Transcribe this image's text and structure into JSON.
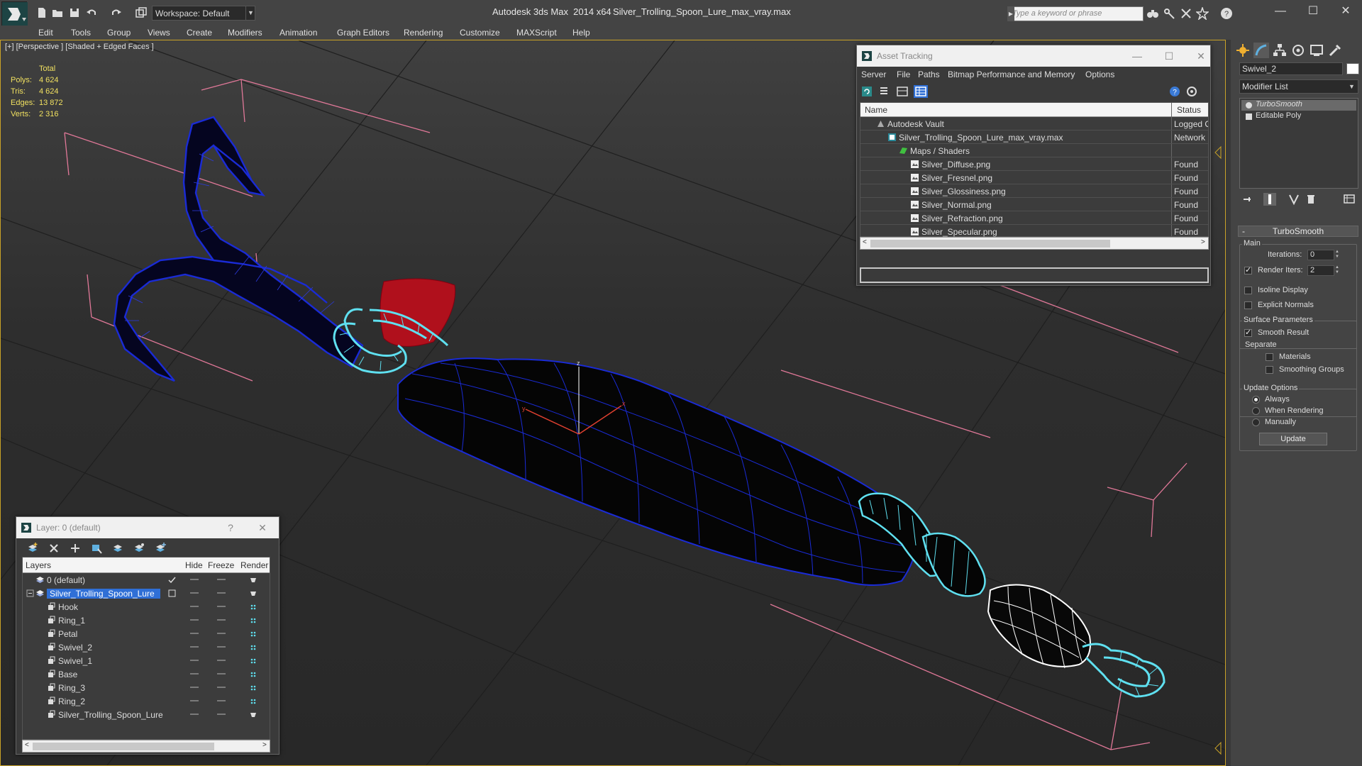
{
  "titlebar": {
    "workspace": "Workspace: Default",
    "app_title": "Autodesk 3ds Max  2014 x64",
    "doc_title": "Silver_Trolling_Spoon_Lure_max_vray.max",
    "search_placeholder": "Type a keyword or phrase",
    "minimize": "—",
    "maximize": "☐",
    "close": "✕"
  },
  "menu": [
    "Edit",
    "Tools",
    "Group",
    "Views",
    "Create",
    "Modifiers",
    "Animation",
    "Graph Editors",
    "Rendering",
    "Customize",
    "MAXScript",
    "Help"
  ],
  "viewport": {
    "label": "[+] [Perspective ] [Shaded + Edged Faces ]",
    "stats_header": "Total",
    "stats": [
      {
        "label": "Polys:",
        "value": "4 624"
      },
      {
        "label": "Tris:",
        "value": "4 624"
      },
      {
        "label": "Edges:",
        "value": "13 872"
      },
      {
        "label": "Verts:",
        "value": "2 316"
      }
    ]
  },
  "asset_tracking": {
    "title": "Asset Tracking",
    "menu": [
      "Server",
      "File",
      "Paths",
      "Bitmap Performance and Memory",
      "Options"
    ],
    "columns": {
      "name": "Name",
      "status": "Status"
    },
    "rows": [
      {
        "name": "Autodesk Vault",
        "status": "Logged O",
        "icon": "vault-icon",
        "indent": 1
      },
      {
        "name": "Silver_Trolling_Spoon_Lure_max_vray.max",
        "status": "Network F",
        "icon": "max-file-icon",
        "indent": 2
      },
      {
        "name": "Maps / Shaders",
        "status": "",
        "icon": "maps-folder-icon",
        "indent": 3
      },
      {
        "name": "Silver_Diffuse.png",
        "status": "Found",
        "icon": "bitmap-icon",
        "indent": 4
      },
      {
        "name": "Silver_Fresnel.png",
        "status": "Found",
        "icon": "bitmap-icon",
        "indent": 4
      },
      {
        "name": "Silver_Glossiness.png",
        "status": "Found",
        "icon": "bitmap-icon",
        "indent": 4
      },
      {
        "name": "Silver_Normal.png",
        "status": "Found",
        "icon": "bitmap-icon",
        "indent": 4
      },
      {
        "name": "Silver_Refraction.png",
        "status": "Found",
        "icon": "bitmap-icon",
        "indent": 4
      },
      {
        "name": "Silver_Specular.png",
        "status": "Found",
        "icon": "bitmap-icon",
        "indent": 4
      }
    ],
    "scroll_left": "<",
    "scroll_right": ">"
  },
  "layer_window": {
    "title": "Layer: 0 (default)",
    "help": "?",
    "close": "✕",
    "columns": {
      "layers": "Layers",
      "hide": "Hide",
      "freeze": "Freeze",
      "render": "Render"
    },
    "rows": [
      {
        "name": "0 (default)",
        "indent": 1,
        "selected": false
      },
      {
        "name": "Silver_Trolling_Spoon_Lure",
        "indent": 1,
        "selected": true
      },
      {
        "name": "Hook",
        "indent": 2,
        "selected": false
      },
      {
        "name": "Ring_1",
        "indent": 2,
        "selected": false
      },
      {
        "name": "Petal",
        "indent": 2,
        "selected": false
      },
      {
        "name": "Swivel_2",
        "indent": 2,
        "selected": false
      },
      {
        "name": "Swivel_1",
        "indent": 2,
        "selected": false
      },
      {
        "name": "Base",
        "indent": 2,
        "selected": false
      },
      {
        "name": "Ring_3",
        "indent": 2,
        "selected": false
      },
      {
        "name": "Ring_2",
        "indent": 2,
        "selected": false
      },
      {
        "name": "Silver_Trolling_Spoon_Lure",
        "indent": 2,
        "selected": false
      }
    ],
    "scroll_left": "<",
    "scroll_right": ">"
  },
  "command_panel": {
    "object_name": "Swivel_2",
    "modifier_list": "Modifier List",
    "stack": [
      "TurboSmooth",
      "Editable Poly"
    ],
    "turbosmooth": {
      "rollout_title": "TurboSmooth",
      "collapse": "-",
      "main_group": "Main",
      "iterations_label": "Iterations:",
      "iterations_value": "0",
      "render_iters_label": "Render Iters:",
      "render_iters_value": "2",
      "isoline_label": "Isoline Display",
      "explicit_normals_label": "Explicit Normals",
      "surface_group": "Surface Parameters",
      "smooth_result_label": "Smooth Result",
      "separate_label": "Separate",
      "materials_label": "Materials",
      "smoothing_groups_label": "Smoothing Groups",
      "update_group": "Update Options",
      "always_label": "Always",
      "when_rendering_label": "When Rendering",
      "manually_label": "Manually",
      "update_button": "Update"
    }
  },
  "colors": {
    "accent_selection": "#2f6fd6",
    "viewport_border": "#c9a227",
    "wire_blue": "#1a2bd6",
    "wire_cyan": "#5fe0f0",
    "petal_red": "#b0101c",
    "stats_yellow": "#f0e060"
  }
}
